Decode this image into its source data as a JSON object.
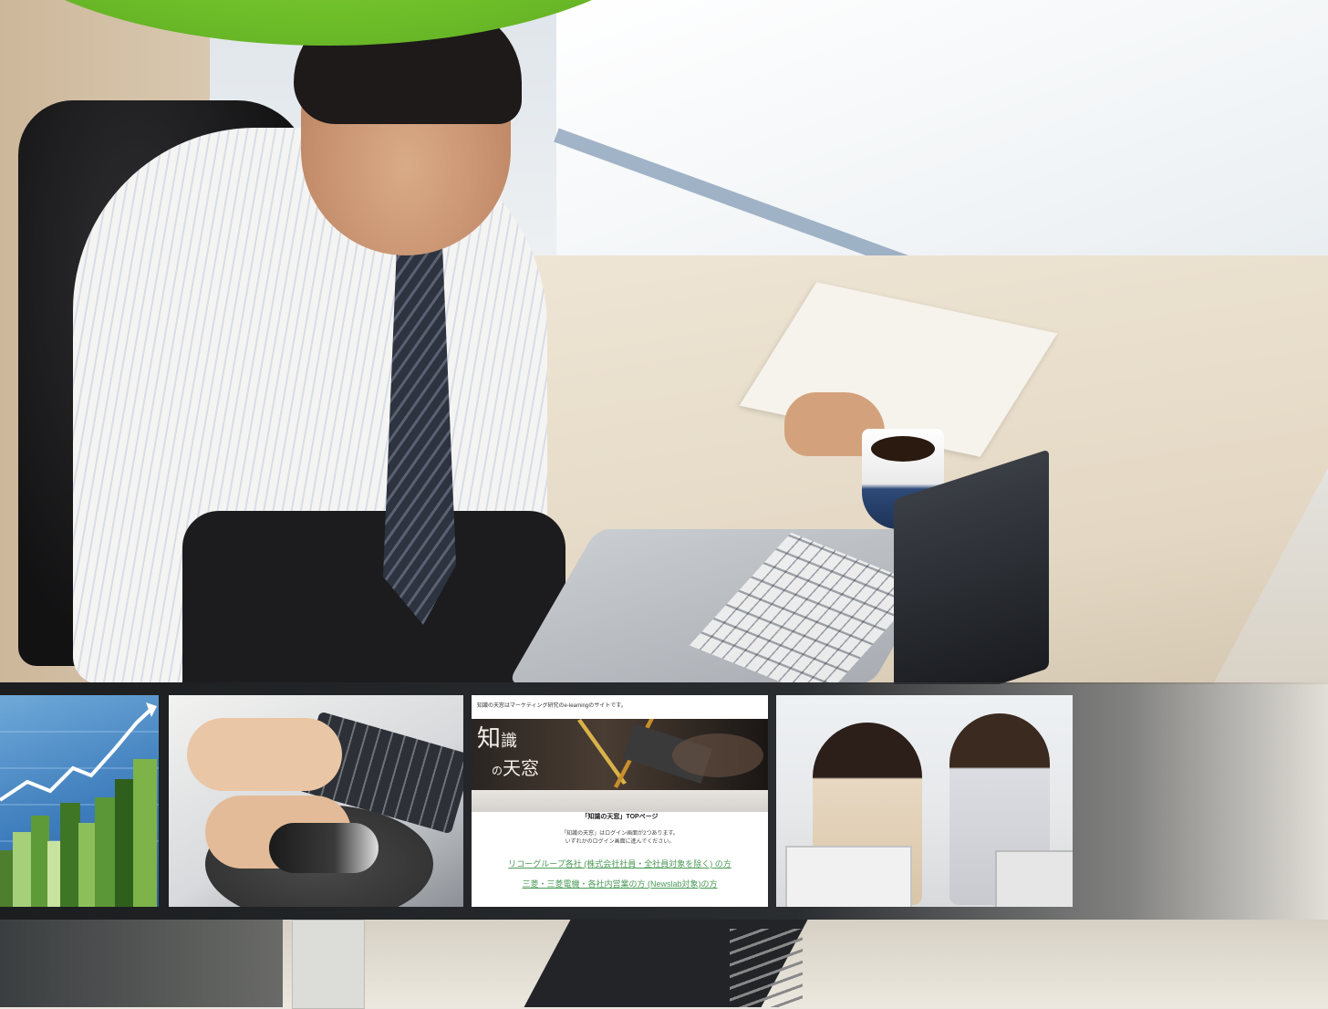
{
  "thumbnails": [
    {
      "subject": "chart-growth"
    },
    {
      "subject": "hands-keyboard-mouse"
    },
    {
      "subject": "webpage-screenshot",
      "webpage": {
        "top_note": "知識の天窓はマーケティング研究のe-learningのサイトです。",
        "logo_line1": "知",
        "logo_line2": "識",
        "logo_line3": "の",
        "logo_line4": "天窓",
        "heading": "「知識の天窓」TOPページ",
        "body_line1": "「知識の天窓」はログイン画面が2つあります。",
        "body_line2": "いずれかのログイン画面に進んでください。",
        "link1": "リコーグループ各社 (株式会社社員・全社員対象を除く) の方",
        "link2": "三菱・三菱電機・各社内営業の方 (Newslab対象)の方"
      }
    },
    {
      "subject": "two-women-at-computer"
    }
  ],
  "colors": {
    "accent_green": "#6fbf2a",
    "link_green": "#4b9a57",
    "strip_dark": "#1b1d1f"
  }
}
